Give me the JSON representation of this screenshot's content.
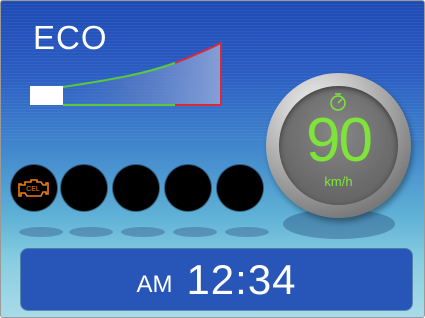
{
  "eco": {
    "label": "ECO",
    "level": 0.32
  },
  "indicators": {
    "check_engine_label": "CEL",
    "check_engine_color": "#f07d1a",
    "lamp_count": 5
  },
  "speedometer": {
    "value": "90",
    "unit": "km/h",
    "value_color": "#7ee43a"
  },
  "clock": {
    "period": "AM",
    "time": "12:34"
  },
  "colors": {
    "eco_green": "#5cc83c",
    "eco_red": "#d8283a"
  }
}
